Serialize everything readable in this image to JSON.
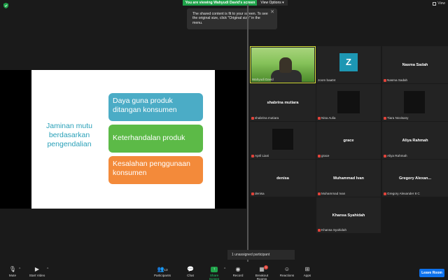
{
  "topbar": {
    "banner": "You are viewing Wahyudi David's screen",
    "view_options": "View Options",
    "view_options_caret": "▾",
    "view_label": "View",
    "tooltip_text": "The shared content is fit to your screen. To see the original size, click \"Original size\" in the menu.",
    "tooltip_close": "✕"
  },
  "slide": {
    "heading": "Jaminan mutu berdasarkan pengendalian",
    "boxes": [
      {
        "text": "Daya guna produk ditangan konsumen",
        "color": "#4bacc6"
      },
      {
        "text": "Keterhandalan produk",
        "color": "#5cba47"
      },
      {
        "text": "Kesalahan penggunaan konsumen",
        "color": "#f38a3a"
      }
    ]
  },
  "participants": [
    {
      "label": "Wahyudi David",
      "center": "",
      "type": "video"
    },
    {
      "label": "zoom baa04",
      "center": "Z",
      "type": "avatar"
    },
    {
      "label": "Nasma Sadah",
      "center": "Nasma Sadah",
      "type": "name"
    },
    {
      "label": "shabrina mutiara",
      "center": "shabrina mutiara",
      "type": "name"
    },
    {
      "label": "Nisa Aulia",
      "center": "",
      "type": "dark"
    },
    {
      "label": "Tiara Novisany",
      "center": "",
      "type": "dark"
    },
    {
      "label": "April Liani",
      "center": "",
      "type": "dark"
    },
    {
      "label": "grace",
      "center": "grace",
      "type": "name"
    },
    {
      "label": "Aliya Rahmah",
      "center": "Aliya Rahmah",
      "type": "name"
    },
    {
      "label": "denisa",
      "center": "denisa",
      "type": "name"
    },
    {
      "label": "Muhammad Ivan",
      "center": "Muhammad Ivan",
      "type": "name"
    },
    {
      "label": "Gregory Alexander 8 C",
      "center": "Gregory  Alexan...",
      "type": "name"
    },
    {
      "label": "Khansa Syahidah",
      "center": "Khansa Syahidah",
      "type": "name"
    }
  ],
  "unassigned": "1 unassigned participant",
  "toolbar": {
    "mute": "Mute",
    "start_video": "Start Video",
    "participants": "Participants",
    "participants_count": "13",
    "chat": "Chat",
    "share_screen": "Share Screen",
    "record": "Record",
    "breakout_rooms": "Breakout Rooms",
    "breakout_badge": "1",
    "reactions": "Reactions",
    "apps": "Apps",
    "leave": "Leave Room",
    "caret": "^"
  }
}
